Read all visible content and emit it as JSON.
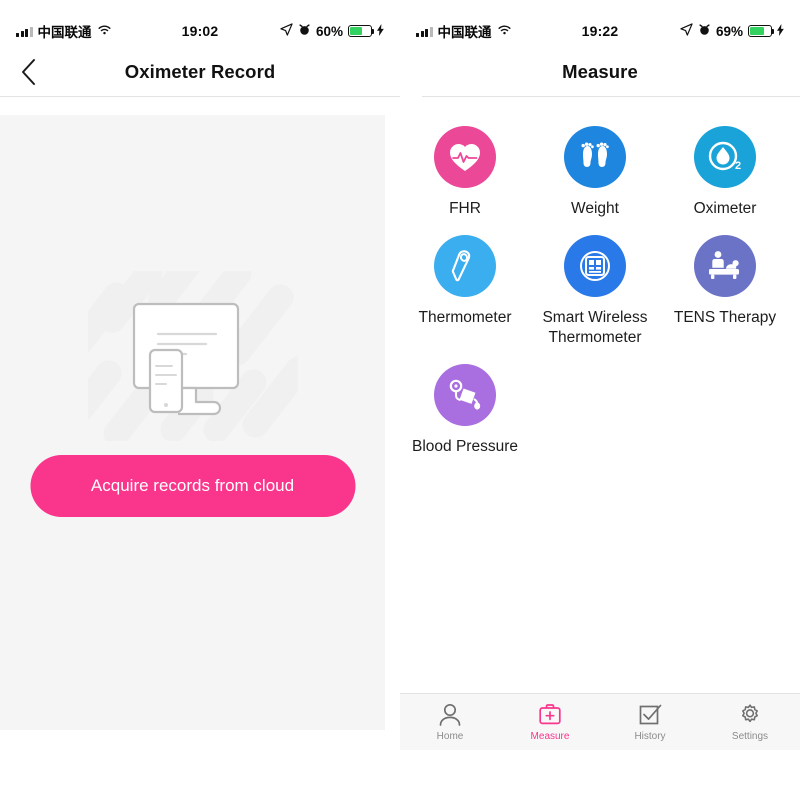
{
  "left_screen": {
    "status_bar": {
      "carrier": "中国联通",
      "time": "19:02",
      "battery_percent": "60%",
      "signal_icon": "signal-bars-icon",
      "wifi_icon": "wifi-icon",
      "location_icon": "location-arrow-icon",
      "alarm_icon": "alarm-clock-icon",
      "battery_icon": "battery-icon",
      "charging_icon": "lightning-bolt-icon",
      "battery_fill_color": "#33d15f",
      "battery_fill_pct": 60
    },
    "nav": {
      "title": "Oximeter Record",
      "back_icon": "chevron-left-icon"
    },
    "empty_state": {
      "illustration_icon": "desktop-and-phone-illustration",
      "background_color": "#f5f5f5"
    },
    "cloud_button": {
      "label": "Acquire records from cloud",
      "color": "#f9358c",
      "text_color": "#ffffff"
    }
  },
  "right_screen": {
    "status_bar": {
      "carrier": "中国联通",
      "time": "19:22",
      "battery_percent": "69%",
      "signal_icon": "signal-bars-icon",
      "wifi_icon": "wifi-icon",
      "location_icon": "location-arrow-icon",
      "alarm_icon": "alarm-clock-icon",
      "battery_icon": "battery-icon",
      "charging_icon": "lightning-bolt-icon",
      "battery_fill_color": "#33d15f",
      "battery_fill_pct": 69
    },
    "nav": {
      "title": "Measure"
    },
    "measure_items": [
      {
        "label": "FHR",
        "icon": "heart-pulse-icon",
        "color": "#ec4898"
      },
      {
        "label": "Weight",
        "icon": "footprints-icon",
        "color": "#1f86e0"
      },
      {
        "label": "Oximeter",
        "icon": "oxygen-droplet-o2-icon",
        "color": "#19a3d8"
      },
      {
        "label": "Thermometer",
        "icon": "thermometer-probe-icon",
        "color": "#3baef0"
      },
      {
        "label": "Smart Wireless Thermometer",
        "icon": "qr-grid-panel-icon",
        "color": "#2979e8"
      },
      {
        "label": "TENS Therapy",
        "icon": "massage-therapy-icon",
        "color": "#6b73c7"
      },
      {
        "label": "Blood Pressure",
        "icon": "blood-pressure-cuff-icon",
        "color": "#a96ee0"
      }
    ],
    "tabs": [
      {
        "label": "Home",
        "icon": "person-icon",
        "active": false
      },
      {
        "label": "Measure",
        "icon": "medical-kit-icon",
        "active": true
      },
      {
        "label": "History",
        "icon": "checked-box-icon",
        "active": false
      },
      {
        "label": "Settings",
        "icon": "gear-icon",
        "active": false
      }
    ],
    "active_tab_color": "#f9358c",
    "inactive_tab_color": "#8b8b8b"
  }
}
